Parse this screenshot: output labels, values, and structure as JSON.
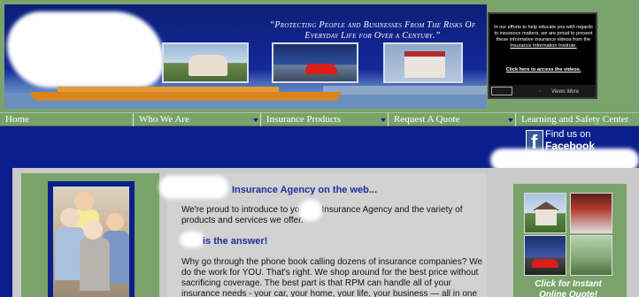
{
  "header": {
    "slogan": "“Protecting People and Businesses From The Risks Of Everyday Life for Over a Century.”",
    "video_box": {
      "intro": "In our efforts to help educate you with regards to insurance matters, we are proud to present these informative insurance videos from the",
      "institute": "Insurance Information Institute.",
      "link": "Click here to access the videos.",
      "prev": "◦",
      "more": "Views More"
    }
  },
  "nav": {
    "items": [
      {
        "label": "Home",
        "dropdown": false
      },
      {
        "label": "Who We Are",
        "dropdown": true
      },
      {
        "label": "Insurance Products",
        "dropdown": true
      },
      {
        "label": "Request A Quote",
        "dropdown": true
      },
      {
        "label": "Learning and Safety Center",
        "dropdown": false
      }
    ]
  },
  "facebook": {
    "line1": "Find us on",
    "line2": "Facebook",
    "logo_letter": "f"
  },
  "main": {
    "heading1": "Insurance Agency on the web...",
    "para1": "We're proud to introduce to you the Insurance Agency and the variety of products and services we offer.",
    "heading2": "is the answer!",
    "para2": "Why go through the phone book calling dozens of insurance companies?  We do the work for YOU.   That's right. We shop around for the best price without sacrificing coverage.  The best part is that RPM can handle all of your insurance needs - your car, your home, your life, your business — all in one place, all at"
  },
  "sidebar": {
    "quote_line1": "Click for Instant",
    "quote_line2": "Online Quote!"
  },
  "colors": {
    "navy": "#0a1f8c",
    "green": "#7aa36b",
    "heading_blue": "#1f2f9c"
  }
}
